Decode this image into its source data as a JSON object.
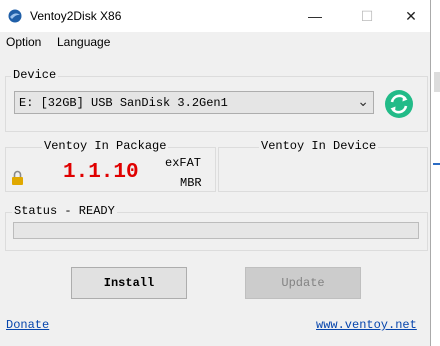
{
  "window": {
    "title": "Ventoy2Disk  X86",
    "controls": {
      "minimize": "—",
      "maximize": "☐",
      "close": "✕"
    }
  },
  "menu": {
    "items": [
      "Option",
      "Language"
    ]
  },
  "device": {
    "label": "Device",
    "selected": "E: [32GB] USB SanDisk 3.2Gen1",
    "refresh_icon": "refresh-icon"
  },
  "package": {
    "label": "Ventoy In Package",
    "version": "1.1.10",
    "filesystem": "exFAT",
    "partition": "MBR"
  },
  "device_info": {
    "label": "Ventoy In Device"
  },
  "status": {
    "label": "Status - READY",
    "progress_fraction": 0
  },
  "buttons": {
    "install": "Install",
    "update": "Update"
  },
  "links": {
    "donate": "Donate",
    "website": "www.ventoy.net"
  },
  "colors": {
    "version": "#e00000",
    "refresh": "#22bb88",
    "lock": "#e0a800",
    "link": "#0645ad"
  }
}
